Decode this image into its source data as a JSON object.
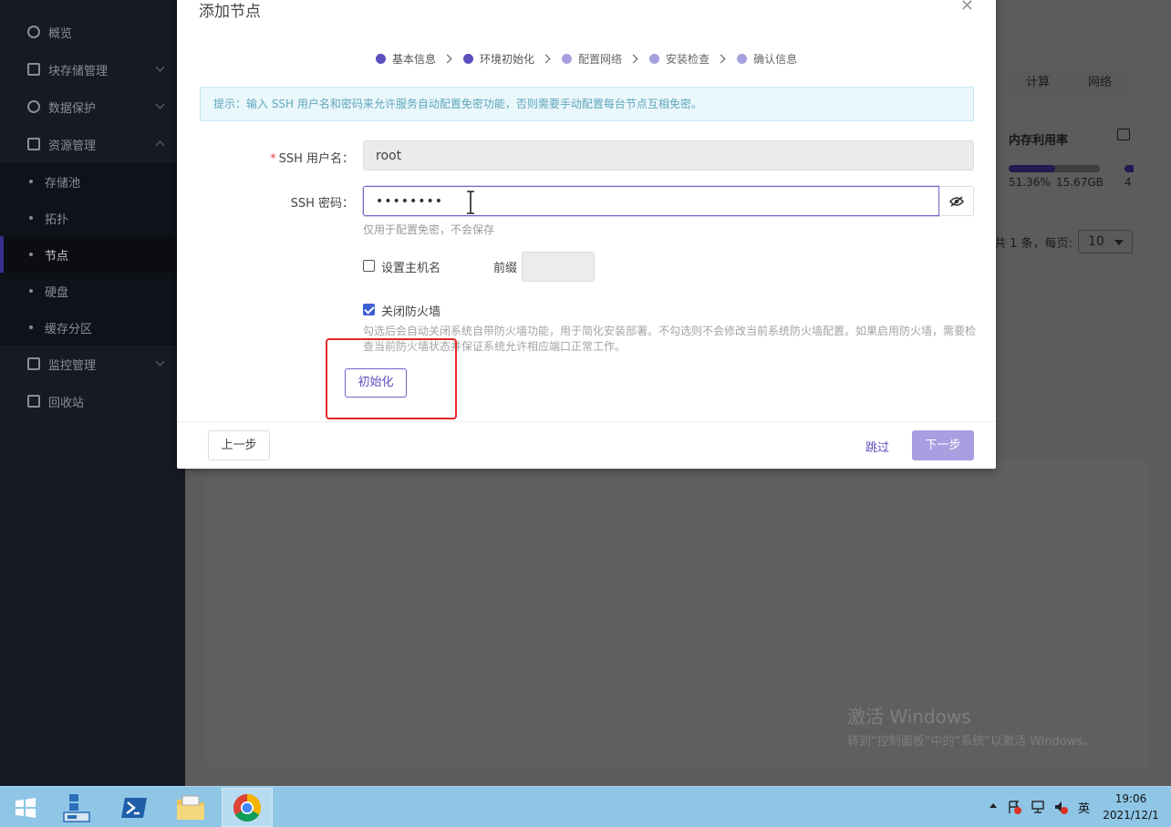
{
  "sidebar": {
    "items": [
      {
        "label": "概览",
        "icon": "dashboard-icon"
      },
      {
        "label": "块存储管理",
        "icon": "database-icon"
      },
      {
        "label": "数据保护",
        "icon": "shield-icon"
      },
      {
        "label": "资源管理",
        "icon": "resource-icon"
      },
      {
        "label": "存储池"
      },
      {
        "label": "拓扑"
      },
      {
        "label": "节点"
      },
      {
        "label": "硬盘"
      },
      {
        "label": "缓存分区"
      },
      {
        "label": "监控管理",
        "icon": "monitor-icon"
      },
      {
        "label": "回收站",
        "icon": "recycle-icon"
      }
    ]
  },
  "background": {
    "tabs": [
      "计算",
      "网络"
    ],
    "column_header": "内存利用率",
    "memory_percent": "51.36%",
    "memory_size": "15.67GB",
    "memory_fraction": 0.5136,
    "cut_value": "4",
    "pagination_text": "共 1 条，每页:",
    "page_size": "10"
  },
  "watermark": {
    "line1": "激活 Windows",
    "line2": "转到“控制面板”中的“系统”以激活 Windows。"
  },
  "modal": {
    "title": "添加节点",
    "steps": [
      {
        "label": "基本信息",
        "state": "done"
      },
      {
        "label": "环境初始化",
        "state": "current"
      },
      {
        "label": "配置网络",
        "state": "pending"
      },
      {
        "label": "安装检查",
        "state": "pending"
      },
      {
        "label": "确认信息",
        "state": "pending"
      }
    ],
    "tip": "提示：输入 SSH 用户名和密码来允许服务自动配置免密功能，否则需要手动配置每台节点互相免密。",
    "ssh_user_label": "SSH 用户名：",
    "ssh_user_value": "root",
    "ssh_pwd_label": "SSH 密码：",
    "ssh_pwd_value": "••••••••",
    "pwd_help": "仅用于配置免密，不会保存",
    "set_hostname_label": "设置主机名",
    "prefix_label": "前缀",
    "firewall_label": "关闭防火墙",
    "firewall_help": "勾选后会自动关闭系统自带防火墙功能，用于简化安装部署。不勾选则不会修改当前系统防火墙配置。如果启用防火墙，需要检查当前防火墙状态并保证系统允许相应端口正常工作。",
    "init_button": "初始化",
    "prev_button": "上一步",
    "skip_link": "跳过",
    "next_button": "下一步"
  },
  "taskbar": {
    "ime": "英",
    "time": "19:06",
    "date": "2021/12/1"
  },
  "colors": {
    "accent": "#5b4fbd",
    "highlight": "#e3262a",
    "sidebar_bg": "#161a24"
  }
}
